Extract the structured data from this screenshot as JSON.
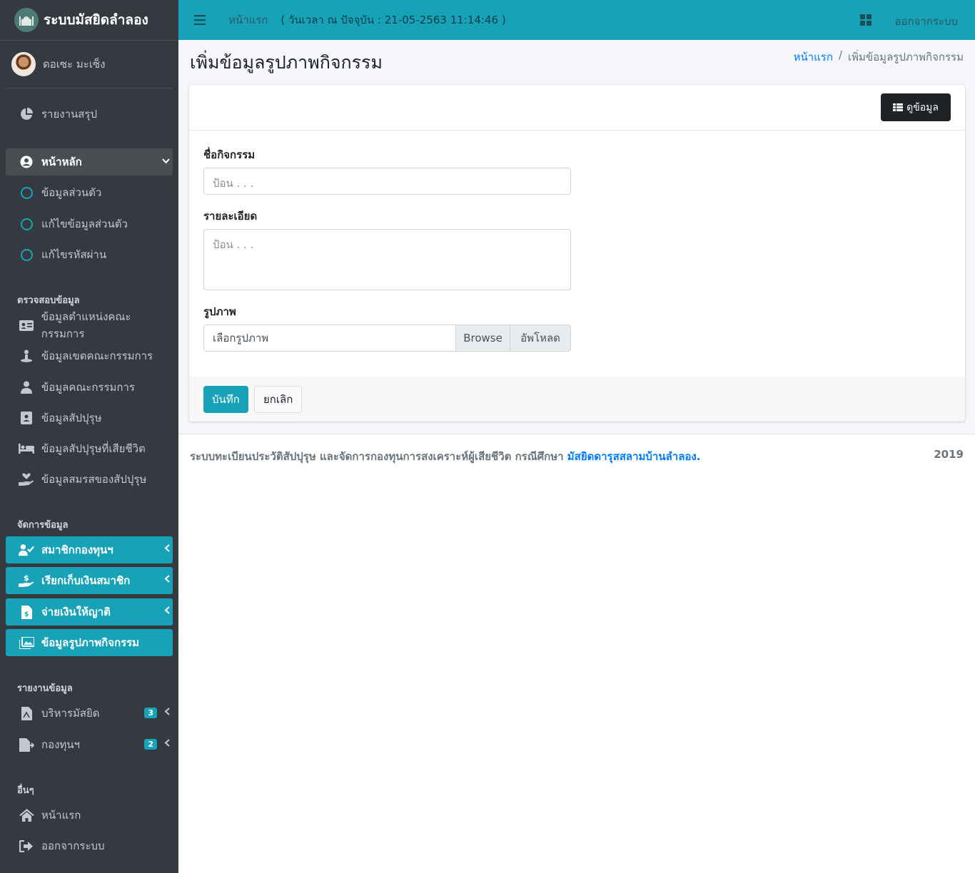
{
  "brand": {
    "title": "ระบบมัสยิดลำลอง"
  },
  "user": {
    "name": "ดอเซะ มะเซ็ง"
  },
  "sidebar": {
    "summary": "รายงานสรุป",
    "main": "หน้าหลัก",
    "main_items": [
      "ข้อมูลส่วนตัว",
      "แก้ไขข้อมูลส่วนตัว",
      "แก้ไขรหัสผ่าน"
    ],
    "header_check": "ตรวจสอบข้อมูล",
    "check_items": [
      "ข้อมูลตำแหน่งคณะกรรมการ",
      "ข้อมูลเขตคณะกรรมการ",
      "ข้อมูลคณะกรรมการ",
      "ข้อมูลสัปปุรุษ",
      "ข้อมูลสัปปุรุษที่เสียชีวิต",
      "ข้อมูลสมรสของสัปปุรุษ"
    ],
    "header_manage": "จัดการข้อมูล",
    "manage_items": [
      "สมาชิกกองทุนฯ",
      "เรียกเก็บเงินสมาชิก",
      "จ่ายเงินให้ญาติ",
      "ข้อมูลรูปภาพกิจกรรม"
    ],
    "header_report": "รายงานข้อมูล",
    "report_items": [
      {
        "label": "บริหารมัสยิด",
        "badge": "3"
      },
      {
        "label": "กองทุนฯ",
        "badge": "2"
      }
    ],
    "header_other": "อื่นๆ",
    "other_items": [
      "หน้าแรก",
      "ออกจากระบบ"
    ]
  },
  "topbar": {
    "home": "หน้าแรก",
    "datetime": "( วันเวลา ณ ปัจจุบัน : 21-05-2563 11:14:46 )",
    "logout": "ออกจากระบบ"
  },
  "page": {
    "title": "เพิ่มข้อมูลรูปภาพกิจกรรม",
    "breadcrumb_home": "หน้าแรก",
    "breadcrumb_sep": "/",
    "breadcrumb_current": "เพิ่มข้อมูลรูปภาพกิจกรรม"
  },
  "form": {
    "view_button": "ดูข้อมูล",
    "name_label": "ชื่อกิจกรรม",
    "name_placeholder": "ป้อน . . .",
    "detail_label": "รายละเอียด",
    "detail_placeholder": "ป้อน . . .",
    "image_label": "รูปภาพ",
    "file_placeholder": "เลือกรูปภาพ",
    "browse": "Browse",
    "upload": "อัพโหลด",
    "save": "บันทึก",
    "cancel": "ยกเลิก"
  },
  "footer": {
    "text": "ระบบทะเบียนประวัติสัปปุรุษ และจัดการกองทุนการสงเคราะห์ผู้เสียชีวิต กรณีศึกษา",
    "link": "มัสยิดดารุสสลามบ้านลำลอง.",
    "year": "2019"
  },
  "colors": {
    "accent": "#17a2b8",
    "sidebar": "#343a40",
    "dark_button": "#1f2326"
  }
}
